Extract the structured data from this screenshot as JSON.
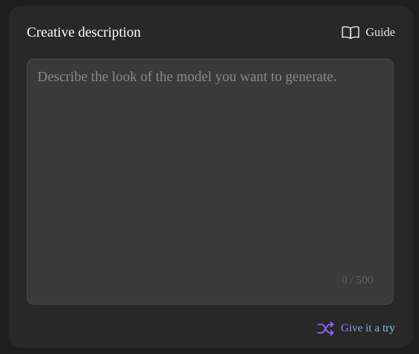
{
  "panel": {
    "title": "Creative description",
    "guide_label": "Guide",
    "guide_icon": "book-open-icon"
  },
  "prompt": {
    "value": "",
    "placeholder": "Describe the look of the model you want to generate.",
    "counter": "0 / 500"
  },
  "try_button": {
    "label": "Give it a try",
    "icon": "shuffle-icon"
  },
  "colors": {
    "background": "#1e1e1e",
    "panel": "#282828",
    "input": "#3a3a3a",
    "accent_start": "#9b7bf3",
    "accent_end": "#7ddbd8"
  }
}
